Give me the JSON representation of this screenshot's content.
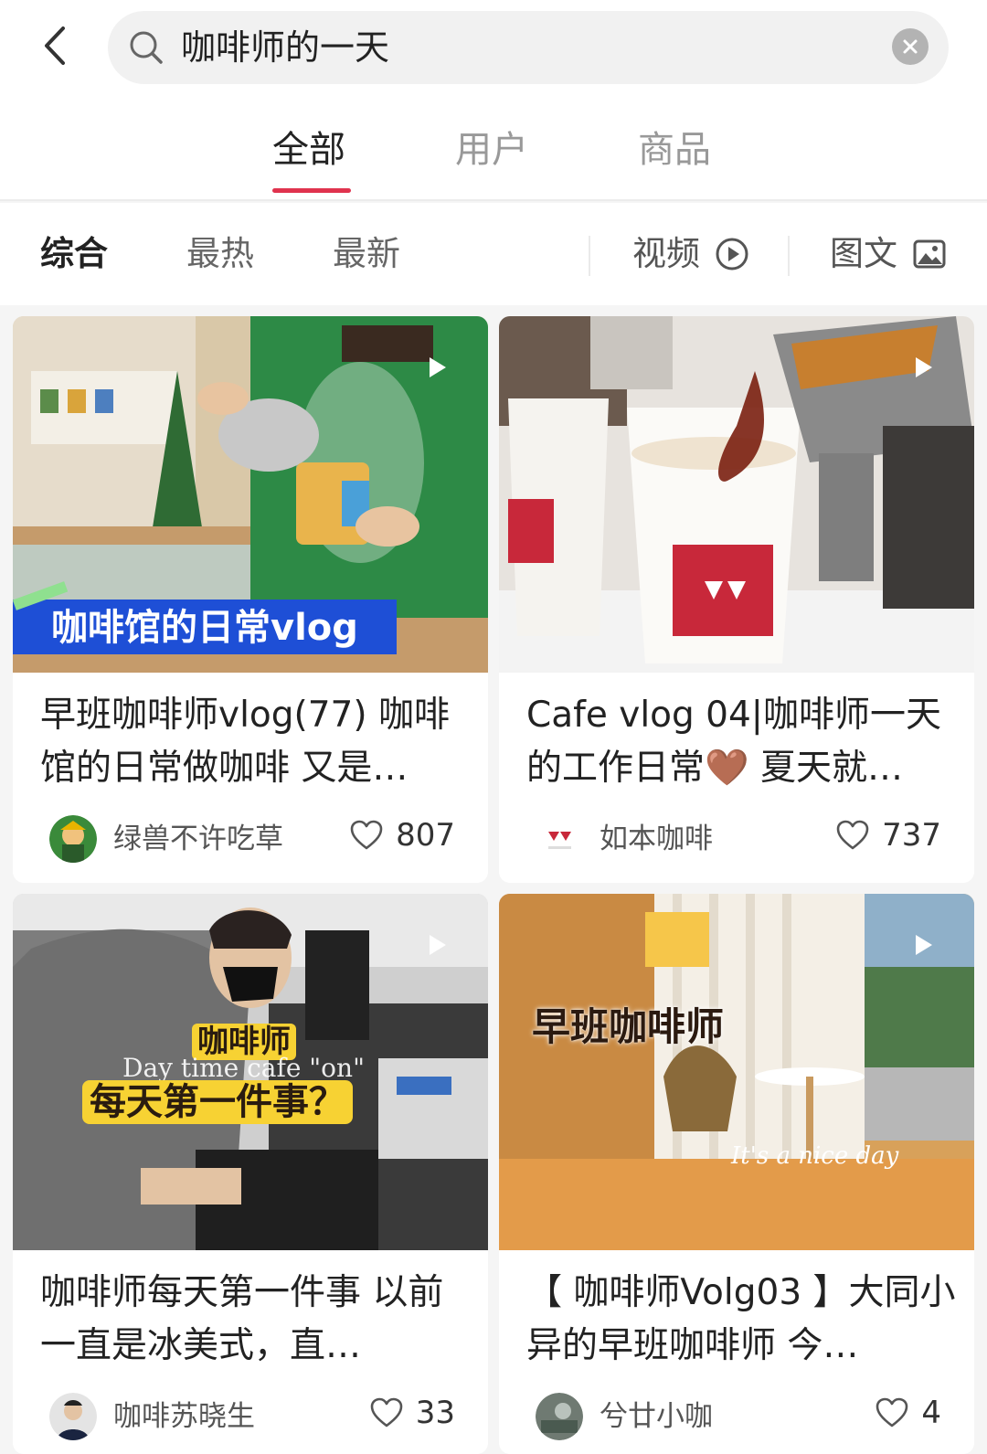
{
  "search": {
    "query": "咖啡师的一天"
  },
  "main_tabs": [
    {
      "label": "全部",
      "active": true
    },
    {
      "label": "用户",
      "active": false
    },
    {
      "label": "商品",
      "active": false
    }
  ],
  "filters": {
    "sort": [
      {
        "label": "综合",
        "active": true
      },
      {
        "label": "最热",
        "active": false
      },
      {
        "label": "最新",
        "active": false
      }
    ],
    "video_label": "视频",
    "image_label": "图文"
  },
  "cards": [
    {
      "overlay": "咖啡馆的日常vlog",
      "title": "早班咖啡师vlog(77) 咖啡馆的日常做咖啡 又是…",
      "author": "绿兽不许吃草",
      "likes": "807"
    },
    {
      "overlay": "",
      "title": "Cafe vlog 04|咖啡师一天的工作日常🤎 夏天就…",
      "author": "如本咖啡",
      "likes": "737"
    },
    {
      "overlay_line1": "咖啡师",
      "overlay_line2": "每天第一件事？",
      "overlay_script": "Day time cafe \"on\"",
      "title": "咖啡师每天第一件事 以前一直是冰美式，直…",
      "author": "咖啡苏晓生",
      "likes": "33"
    },
    {
      "overlay": "早班咖啡师",
      "overlay_script": "It's a nice day",
      "title": "【 咖啡师Volg03 】大同小异的早班咖啡师 今…",
      "author": "兮廿小咖",
      "likes": "4"
    }
  ],
  "colors": {
    "accent": "#e0334e"
  }
}
